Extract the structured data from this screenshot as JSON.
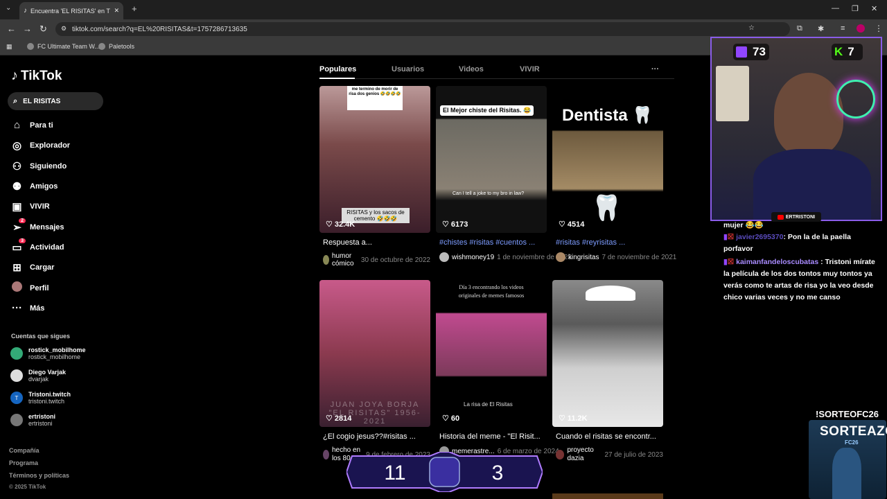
{
  "browser": {
    "tab_title": "Encuentra 'EL RISITAS' en TikTok",
    "url": "tiktok.com/search?q=EL%20RISITAS&t=1757286713635",
    "bookmarks": [
      "FC Ultimate Team W...",
      "Paletools"
    ]
  },
  "sidebar": {
    "logo": "TikTok",
    "search_value": "EL RISITAS",
    "nav": [
      {
        "label": "Para ti",
        "icon": "home-icon"
      },
      {
        "label": "Explorador",
        "icon": "compass-icon"
      },
      {
        "label": "Siguiendo",
        "icon": "user-follow-icon"
      },
      {
        "label": "Amigos",
        "icon": "friends-icon"
      },
      {
        "label": "VIVIR",
        "icon": "live-icon"
      },
      {
        "label": "Mensajes",
        "icon": "send-icon",
        "badge": "2"
      },
      {
        "label": "Actividad",
        "icon": "activity-icon",
        "badge": "3"
      },
      {
        "label": "Cargar",
        "icon": "upload-icon"
      },
      {
        "label": "Perfil",
        "icon": "avatar-icon"
      },
      {
        "label": "Más",
        "icon": "more-icon"
      }
    ],
    "following_title": "Cuentas que sigues",
    "following": [
      {
        "name": "rostick_mobilhome",
        "handle": "rostick_mobilhome"
      },
      {
        "name": "Diego Varjak",
        "handle": "dvarjak"
      },
      {
        "name": "Tristoni.twitch",
        "handle": "tristoni.twitch",
        "initial": "T"
      },
      {
        "name": "ertristoni",
        "handle": "ertristoni"
      }
    ],
    "footer": [
      "Compañía",
      "Programa",
      "Términos y políticas",
      "© 2025 TikTok"
    ]
  },
  "tabs": [
    "Populares",
    "Usuarios",
    "Videos",
    "VIVIR"
  ],
  "more_label": "···",
  "videos": [
    {
      "likes": "32.4K",
      "caption": "Respuesta a...",
      "user": "humor cómico",
      "date": "30 de octubre de 2022",
      "thumb_top": "me termino de morir de risa dos genios 🤣🤣🤣🤣",
      "thumb_bottom": "RISITAS y los sacos de cemento 🤣🤣🤣"
    },
    {
      "likes": "6173",
      "caption": "#chistes #risitas #cuentos ...",
      "user": "wishmoney19",
      "date": "1 de noviembre de 2023",
      "thumb_top": "El Mejor chiste del Risitas. 😂",
      "thumb_bottom": "Can I tell a joke to my bro in law?"
    },
    {
      "likes": "4514",
      "caption": "#risitas #reyrisitas ...",
      "user": "kingrisitas",
      "date": "7 de noviembre de 2021",
      "thumb_top": "Dentista 🦷"
    },
    {
      "likes": "2814",
      "caption": "¿El cogio jesus??#risitas ...",
      "user": "hecho en los 80",
      "date": "9 de febrero de 2023",
      "thumb_bottom": "JUAN JOYA BORJA \"EL RISITAS\" 1956-2021"
    },
    {
      "likes": "60",
      "caption": "Historia del meme - \"El Risit...",
      "user": "memerastre...",
      "date": "6 de marzo de 2024",
      "thumb_top": "Día 3 encontrando los videos originales de memes famosos",
      "thumb_bottom": "La risa de El Risitas"
    },
    {
      "likes": "11.2K",
      "caption": "Cuando el risitas se encontr...",
      "user": "proyecto dazia",
      "date": "27 de julio de 2023"
    }
  ],
  "stream": {
    "twitch_viewers": "73",
    "kick_viewers": "7",
    "streamer": "ERTRISTONI",
    "chat": [
      {
        "user": "",
        "text": "mujer 😂😂"
      },
      {
        "user": "javier2695370",
        "text": "Pon la de la paella porfavor"
      },
      {
        "user": "kaimanfandeloscubatas",
        "text": "Tristoni mírate la película de los dos tontos muy tontos ya verás como te artas de risa yo la veo desde chico varias veces y no me canso"
      }
    ],
    "sorteo_command": "!SORTEOFC26",
    "sorteo_title": "SORTEAZO",
    "sorteo_sub": "FC26",
    "score_left": "11",
    "score_right": "3"
  },
  "colors": {
    "accent": "#fe2c55",
    "hashtag": "#7d9cff",
    "twitch": "#9146ff",
    "kick": "#53fc18"
  }
}
